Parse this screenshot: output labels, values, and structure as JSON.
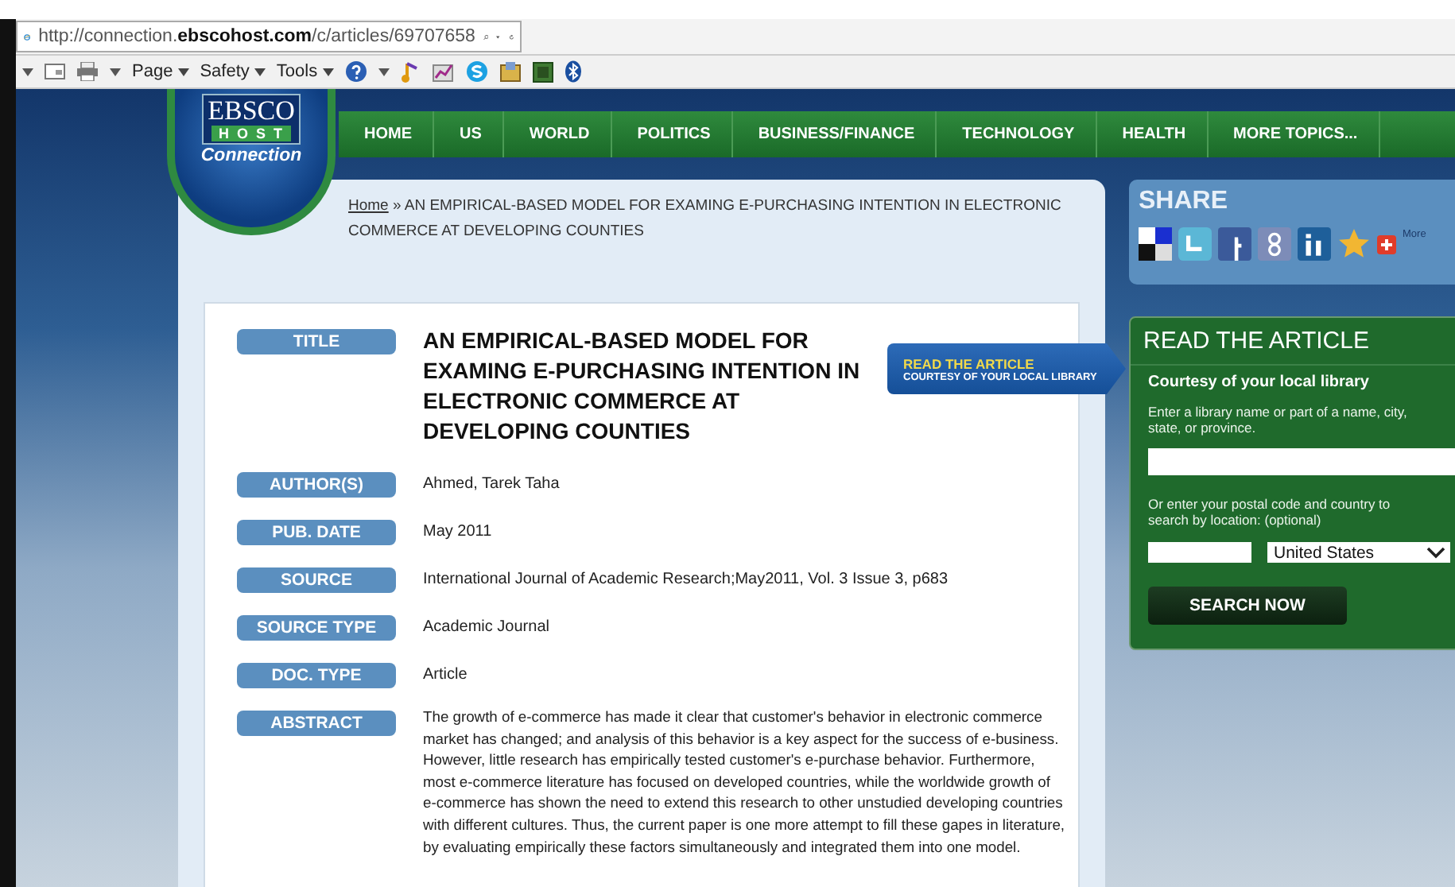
{
  "browser": {
    "url": "http://connection.**ebscohost.com**/c/articles/69707658",
    "commands": [
      "Page",
      "Safety",
      "Tools"
    ]
  },
  "logo": {
    "top": "EBSCO",
    "middle": "HOST",
    "bottom": "Connection"
  },
  "nav": [
    "HOME",
    "US",
    "WORLD",
    "POLITICS",
    "BUSINESS/FINANCE",
    "TECHNOLOGY",
    "HEALTH",
    "MORE TOPICS..."
  ],
  "breadcrumb": {
    "link": "Home",
    "text": "» AN EMPIRICAL-BASED MODEL FOR EXAMING E-PURCHASING INTENTION IN ELECTRONIC COMMERCE AT DEVELOPING COUNTIES"
  },
  "fields": [
    {
      "kind": "title",
      "label": "TITLE",
      "value": "AN EMPIRICAL-BASED MODEL FOR EXAMING E-PURCHASING INTENTION IN ELECTRONIC COMMERCE AT DEVELOPING COUNTIES"
    },
    {
      "kind": "text",
      "label": "AUTHOR(S)",
      "value": "Ahmed, Tarek Taha"
    },
    {
      "kind": "text",
      "label": "PUB. DATE",
      "value": "May 2011"
    },
    {
      "kind": "text",
      "label": "SOURCE",
      "value": "International Journal of Academic Research;May2011, Vol. 3 Issue 3, p683"
    },
    {
      "kind": "text",
      "label": "SOURCE TYPE",
      "value": "Academic Journal"
    },
    {
      "kind": "text",
      "label": "DOC. TYPE",
      "value": "Article"
    },
    {
      "kind": "paragraph",
      "label": "ABSTRACT",
      "value": "The growth of e-commerce has made it clear that customer's behavior in electronic commerce market has changed; and analysis of this behavior is a key aspect for the success of e-business. However, little research has empirically tested customer's e-purchase behavior. Furthermore, most e-commerce literature has focused on developed countries, while the worldwide growth of e-commerce has shown the need to extend this research to other unstudied developing countries with different cultures. Thus, the current paper is one more attempt to fill these gapes in literature, by evaluating empirically these factors simultaneously and integrated them into one model."
    }
  ],
  "callout": {
    "title": "READ THE ARTICLE",
    "subtitle": "COURTESY OF YOUR LOCAL LIBRARY"
  },
  "share": {
    "title": "SHARE",
    "more": "More"
  },
  "library": {
    "title": "READ THE ARTICLE",
    "subtitle": "Courtesy of your local library",
    "hint": "Enter a library name or part of a name, city, state, or province.",
    "location_hint": "Or enter your postal code and country to search by location: (optional)",
    "country": "United States",
    "button": "SEARCH NOW"
  }
}
